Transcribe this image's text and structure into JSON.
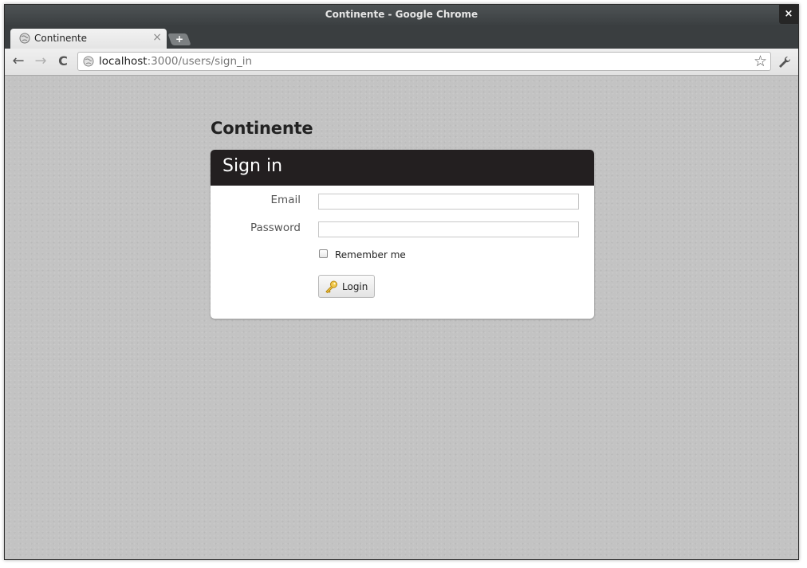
{
  "window": {
    "title": "Continente - Google Chrome",
    "close_glyph": "×"
  },
  "tabs": [
    {
      "title": "Continente",
      "close_glyph": "×",
      "icon": "globe-icon"
    }
  ],
  "new_tab_glyph": "+",
  "toolbar": {
    "back_glyph": "←",
    "forward_glyph": "→",
    "reload_glyph": "C",
    "url_host": "localhost",
    "url_path": ":3000/users/sign_in",
    "bookmark_glyph": "☆"
  },
  "page": {
    "brand": "Continente",
    "panel_title": "Sign in",
    "email_label": "Email",
    "email_value": "",
    "password_label": "Password",
    "password_value": "",
    "remember_label": "Remember me",
    "remember_checked": false,
    "login_label": "Login"
  },
  "colors": {
    "panel_header": "#231f20",
    "page_background": "#c3c3c3",
    "titlebar": "#3a3e40"
  }
}
